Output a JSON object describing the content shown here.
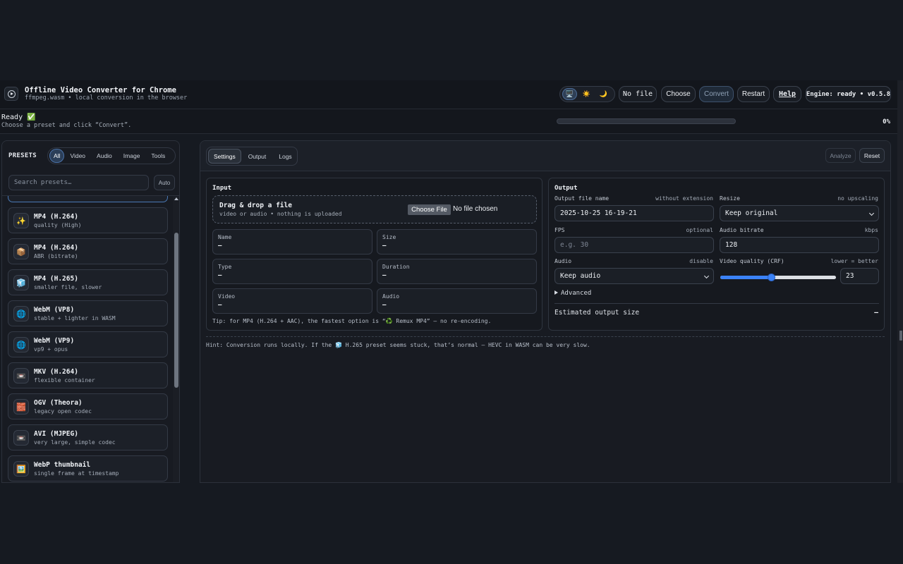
{
  "header": {
    "title": "Offline Video Converter for Chrome",
    "subtitle": "ffmpeg.wasm • local conversion in the browser",
    "theme_icons": [
      "🖥️",
      "☀️",
      "🌙"
    ],
    "file_pill": "No file",
    "choose_label": "Choose",
    "convert_label": "Convert",
    "restart_label": "Restart",
    "help_label": "Help",
    "engine_status": "Engine: ready • v0.5.8"
  },
  "status": {
    "title": "Ready ✅",
    "subtitle": "Choose a preset and click “Convert”.",
    "progress_percent_label": "0%",
    "progress_fraction": 0
  },
  "presets": {
    "title": "PRESETS",
    "filters": [
      "All",
      "Video",
      "Audio",
      "Image",
      "Tools"
    ],
    "active_filter": "All",
    "search_placeholder": "Search presets…",
    "auto_label": "Auto",
    "items": [
      {
        "icon": "✨",
        "name": "MP4 (H.264)",
        "desc": "quality (High)"
      },
      {
        "icon": "📦",
        "name": "MP4 (H.264)",
        "desc": "ABR (bitrate)"
      },
      {
        "icon": "🧊",
        "name": "MP4 (H.265)",
        "desc": "smaller file, slower"
      },
      {
        "icon": "🌐",
        "name": "WebM (VP8)",
        "desc": "stable + lighter in WASM"
      },
      {
        "icon": "🌐",
        "name": "WebM (VP9)",
        "desc": "vp9 + opus"
      },
      {
        "icon": "📼",
        "name": "MKV (H.264)",
        "desc": "flexible container"
      },
      {
        "icon": "🧱",
        "name": "OGV (Theora)",
        "desc": "legacy open codec"
      },
      {
        "icon": "📼",
        "name": "AVI (MJPEG)",
        "desc": "very large, simple codec"
      },
      {
        "icon": "🖼️",
        "name": "WebP thumbnail",
        "desc": "single frame at timestamp"
      }
    ]
  },
  "main": {
    "tabs": [
      "Settings",
      "Output",
      "Logs"
    ],
    "active_tab": "Settings",
    "analyze_label": "Analyze",
    "reset_label": "Reset",
    "input": {
      "title": "Input",
      "drop_title": "Drag & drop a file",
      "drop_subtitle": "video or audio • nothing is uploaded",
      "file_button": "Choose File",
      "file_status": "No file chosen",
      "meta": [
        {
          "key": "Name",
          "value": "—"
        },
        {
          "key": "Size",
          "value": "—"
        },
        {
          "key": "Type",
          "value": "—"
        },
        {
          "key": "Duration",
          "value": "—"
        },
        {
          "key": "Video",
          "value": "—"
        },
        {
          "key": "Audio",
          "value": "—"
        }
      ],
      "tip": "Tip: for MP4 (H.264 + AAC), the fastest option is “♻️ Remux MP4” — no re-encoding."
    },
    "output": {
      "title": "Output",
      "filename_label": "Output file name",
      "filename_hint": "without extension",
      "filename_value": "2025-10-25 16-19-21",
      "resize_label": "Resize",
      "resize_hint": "no upscaling",
      "resize_value": "Keep original",
      "fps_label": "FPS",
      "fps_hint": "optional",
      "fps_placeholder": "e.g. 30",
      "abitrate_label": "Audio bitrate",
      "abitrate_hint": "kbps",
      "abitrate_value": "128",
      "audio_label": "Audio",
      "audio_hint": "disable",
      "audio_value": "Keep audio",
      "crf_label": "Video quality (CRF)",
      "crf_hint": "lower = better",
      "crf_value": "23",
      "crf_fraction": 0.44,
      "advanced_label": "Advanced",
      "estimated_label": "Estimated output size",
      "estimated_value": "—"
    },
    "hint": "Hint: Conversion runs locally. If the 🧊 H.265 preset seems stuck, that’s normal — HEVC in WASM can be very slow."
  }
}
